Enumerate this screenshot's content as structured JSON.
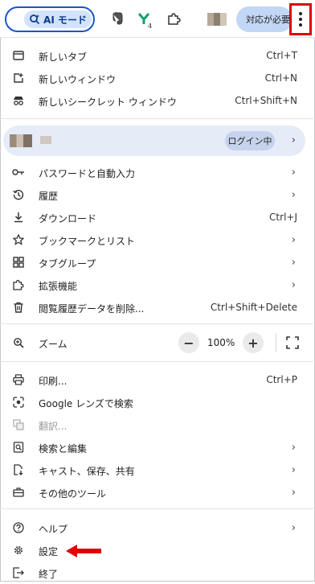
{
  "toolbar": {
    "ai_mode_label": "AI モード",
    "extension_badge": "4",
    "pill_text": "対応が必要",
    "icons": [
      "ai-search-sparkle-icon",
      "evernote-icon",
      "yomiwa-extension-icon",
      "puzzle-extensions-icon",
      "more-vert-icon"
    ]
  },
  "menu": {
    "group1": [
      {
        "label": "新しいタブ",
        "shortcut": "Ctrl+T",
        "icon": "new-tab-icon"
      },
      {
        "label": "新しいウィンドウ",
        "shortcut": "Ctrl+N",
        "icon": "new-window-icon"
      },
      {
        "label": "新しいシークレット ウィンドウ",
        "shortcut": "Ctrl+Shift+N",
        "icon": "incognito-icon"
      }
    ],
    "profile": {
      "status": "ログイン中"
    },
    "group2": [
      {
        "label": "パスワードと自動入力",
        "icon": "key-icon"
      },
      {
        "label": "履歴",
        "icon": "history-icon"
      },
      {
        "label": "ダウンロード",
        "shortcut": "Ctrl+J",
        "icon": "download-icon"
      },
      {
        "label": "ブックマークとリスト",
        "icon": "star-icon"
      },
      {
        "label": "タブグループ",
        "icon": "tab-groups-icon"
      },
      {
        "label": "拡張機能",
        "icon": "puzzle-icon"
      },
      {
        "label": "閲覧履歴データを削除...",
        "shortcut": "Ctrl+Shift+Delete",
        "icon": "trash-icon"
      }
    ],
    "zoom": {
      "label": "ズーム",
      "value": "100%",
      "minus": "−",
      "plus": "+"
    },
    "group3": [
      {
        "label": "印刷...",
        "shortcut": "Ctrl+P",
        "icon": "print-icon"
      },
      {
        "label": "Google レンズで検索",
        "icon": "lens-icon"
      },
      {
        "label": "翻訳...",
        "icon": "translate-icon",
        "disabled": true
      },
      {
        "label": "検索と編集",
        "icon": "find-edit-icon"
      },
      {
        "label": "キャスト、保存、共有",
        "icon": "cast-save-share-icon"
      },
      {
        "label": "その他のツール",
        "icon": "toolbox-icon"
      }
    ],
    "group4": [
      {
        "label": "ヘルプ",
        "icon": "help-icon"
      },
      {
        "label": "設定",
        "icon": "gear-icon"
      },
      {
        "label": "終了",
        "icon": "exit-icon"
      }
    ]
  },
  "colors": {
    "highlight_red": "#e00000",
    "profile_bg": "#e5ebf7",
    "accent_blue": "#1a56c4"
  }
}
